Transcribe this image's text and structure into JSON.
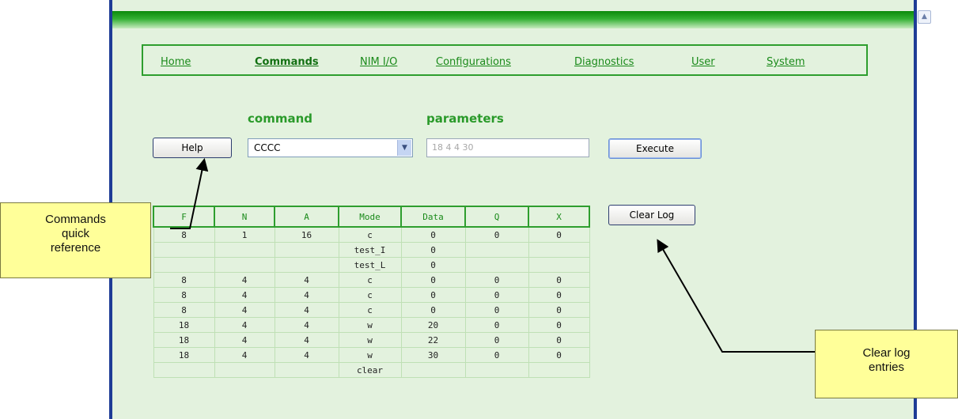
{
  "nav": {
    "items": [
      {
        "label": "Home",
        "active": false
      },
      {
        "label": "Commands",
        "active": true
      },
      {
        "label": "NIM I/O",
        "active": false
      },
      {
        "label": "Configurations",
        "active": false
      },
      {
        "label": "Diagnostics",
        "active": false
      },
      {
        "label": "User",
        "active": false
      },
      {
        "label": "System",
        "active": false
      }
    ]
  },
  "form": {
    "command_label": "command",
    "parameters_label": "parameters",
    "help_button": "Help",
    "command_value": "CCCC",
    "parameters_value": "18 4 4 30",
    "execute_button": "Execute",
    "clear_log_button": "Clear Log"
  },
  "log": {
    "columns": [
      "F",
      "N",
      "A",
      "Mode",
      "Data",
      "Q",
      "X"
    ],
    "rows": [
      [
        "8",
        "1",
        "16",
        "c",
        "0",
        "0",
        "0"
      ],
      [
        "",
        "",
        "",
        "test_I",
        "0",
        "",
        ""
      ],
      [
        "",
        "",
        "",
        "test_L",
        "0",
        "",
        ""
      ],
      [
        "8",
        "4",
        "4",
        "c",
        "0",
        "0",
        "0"
      ],
      [
        "8",
        "4",
        "4",
        "c",
        "0",
        "0",
        "0"
      ],
      [
        "8",
        "4",
        "4",
        "c",
        "0",
        "0",
        "0"
      ],
      [
        "18",
        "4",
        "4",
        "w",
        "20",
        "0",
        "0"
      ],
      [
        "18",
        "4",
        "4",
        "w",
        "22",
        "0",
        "0"
      ],
      [
        "18",
        "4",
        "4",
        "w",
        "30",
        "0",
        "0"
      ],
      [
        "",
        "",
        "",
        "clear",
        "",
        "",
        ""
      ]
    ]
  },
  "callouts": {
    "quick_reference": [
      "Commands",
      "quick",
      "reference"
    ],
    "clear_log": [
      "Clear log",
      "entries"
    ]
  },
  "colors": {
    "accent_green": "#2e9e2e",
    "panel_background": "#e3f2de",
    "callout_yellow": "#ffff99"
  }
}
